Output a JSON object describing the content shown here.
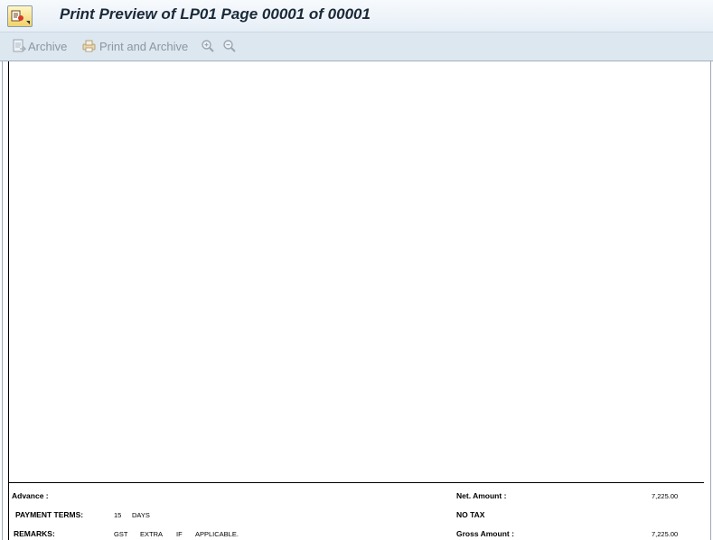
{
  "window": {
    "title": "Print Preview of LP01 Page 00001 of 00001"
  },
  "toolbar": {
    "archive_label": "Archive",
    "print_archive_label": "Print and Archive"
  },
  "document": {
    "advance_label": "Advance :",
    "payment_terms_label": "PAYMENT  TERMS:",
    "payment_terms_value": "15",
    "payment_terms_unit": "DAYS",
    "remarks_label": "REMARKS:",
    "remarks_words": [
      "GST",
      "EXTRA",
      "IF",
      "APPLICABLE."
    ],
    "net_amount_label": "Net. Amount :",
    "net_amount_value": "7,225.00",
    "no_tax_label": "NO  TAX",
    "gross_amount_label": "Gross Amount :",
    "gross_amount_value": "7,225.00"
  }
}
